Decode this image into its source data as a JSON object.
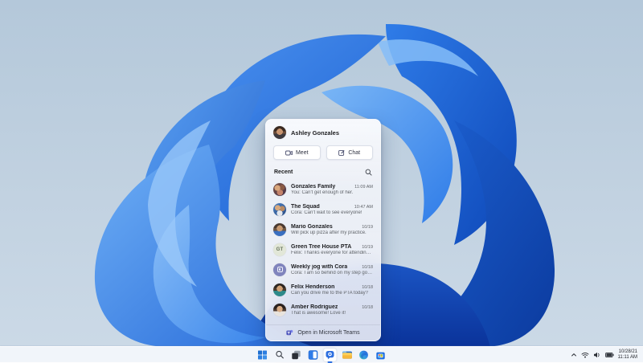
{
  "colors": {
    "accent_blue": "#2e6fe0",
    "bloom_deep": "#0b3a9e",
    "bloom_mid": "#2f7ce8",
    "bloom_light": "#79b5f6",
    "desktop_top": "#b4c8da",
    "desktop_bottom": "#ccdae7",
    "taskbar_bg": "#f2f6fb",
    "teams_purple": "#4b53bc"
  },
  "chat_panel": {
    "user": {
      "name": "Ashley Gonzales",
      "avatar": "photo"
    },
    "actions": {
      "meet_label": "Meet",
      "chat_label": "Chat"
    },
    "recent_label": "Recent",
    "icons": [
      "video-camera-icon",
      "compose-icon",
      "search-icon"
    ],
    "conversations": [
      {
        "name": "Gonzales Family",
        "preview": "You: Can't get enough of her.",
        "time": "11:09 AM",
        "avatar": "photo-group"
      },
      {
        "name": "The Squad",
        "preview": "Cora: Can't wait to see everyone!",
        "time": "10:47 AM",
        "avatar": "photo-group"
      },
      {
        "name": "Mario Gonzales",
        "preview": "Will pick up pizza after my practice.",
        "time": "10/19",
        "avatar": "photo"
      },
      {
        "name": "Green Tree House PTA",
        "preview": "Felix: Thanks everyone for attending today.",
        "time": "10/19",
        "avatar": "initials",
        "initials": "GT"
      },
      {
        "name": "Weekly jog with Cora",
        "preview": "Cora: I am so behind on my step goals.",
        "time": "10/18",
        "avatar": "app-icon"
      },
      {
        "name": "Felix Henderson",
        "preview": "Can you drive me to the PTA today?",
        "time": "10/18",
        "avatar": "photo"
      },
      {
        "name": "Amber Rodriguez",
        "preview": "That is awesome! Love it!",
        "time": "10/18",
        "avatar": "photo"
      }
    ],
    "footer": {
      "open_label": "Open in Microsoft Teams",
      "icon": "teams-icon"
    }
  },
  "taskbar": {
    "icons": [
      "start",
      "search",
      "task-view",
      "widgets",
      "chat",
      "file-explorer",
      "edge",
      "store"
    ],
    "active_icon": "chat",
    "tray_icons": [
      "chevron-up",
      "wifi",
      "volume",
      "battery"
    ],
    "clock": {
      "date": "10/28/21",
      "time": "11:11 AM"
    }
  }
}
